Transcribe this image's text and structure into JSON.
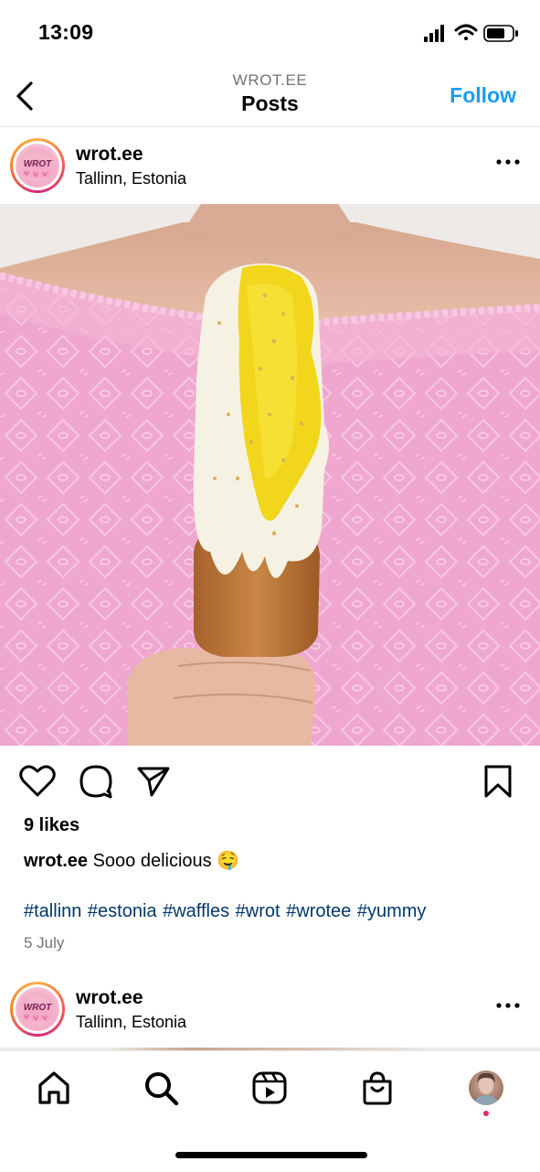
{
  "status_bar": {
    "time": "13:09"
  },
  "header": {
    "subtitle": "WROT.EE",
    "title": "Posts",
    "follow_label": "Follow"
  },
  "post": {
    "username": "wrot.ee",
    "location": "Tallinn, Estonia",
    "likes": "9 likes",
    "caption_user": "wrot.ee",
    "caption_text": "Sooo delicious 🤤",
    "hashtags": "#tallinn #estonia #waffles #wrot #wrotee #yummy",
    "date": "5 July"
  },
  "next_post": {
    "username": "wrot.ee",
    "location": "Tallinn, Estonia"
  },
  "avatar_logo_text": "WROT",
  "icons": {
    "back": "chevron-left-icon",
    "more": "more-horizontal-icon",
    "like": "heart-icon",
    "comment": "comment-bubble-icon",
    "share": "paper-plane-icon",
    "save": "bookmark-icon",
    "home": "home-icon",
    "search": "search-icon",
    "reels": "reels-icon",
    "shop": "shopping-bag-icon"
  },
  "colors": {
    "accent": "#1a9cf0",
    "hashtag": "#00376b",
    "notification_dot": "#ed2a5b"
  }
}
